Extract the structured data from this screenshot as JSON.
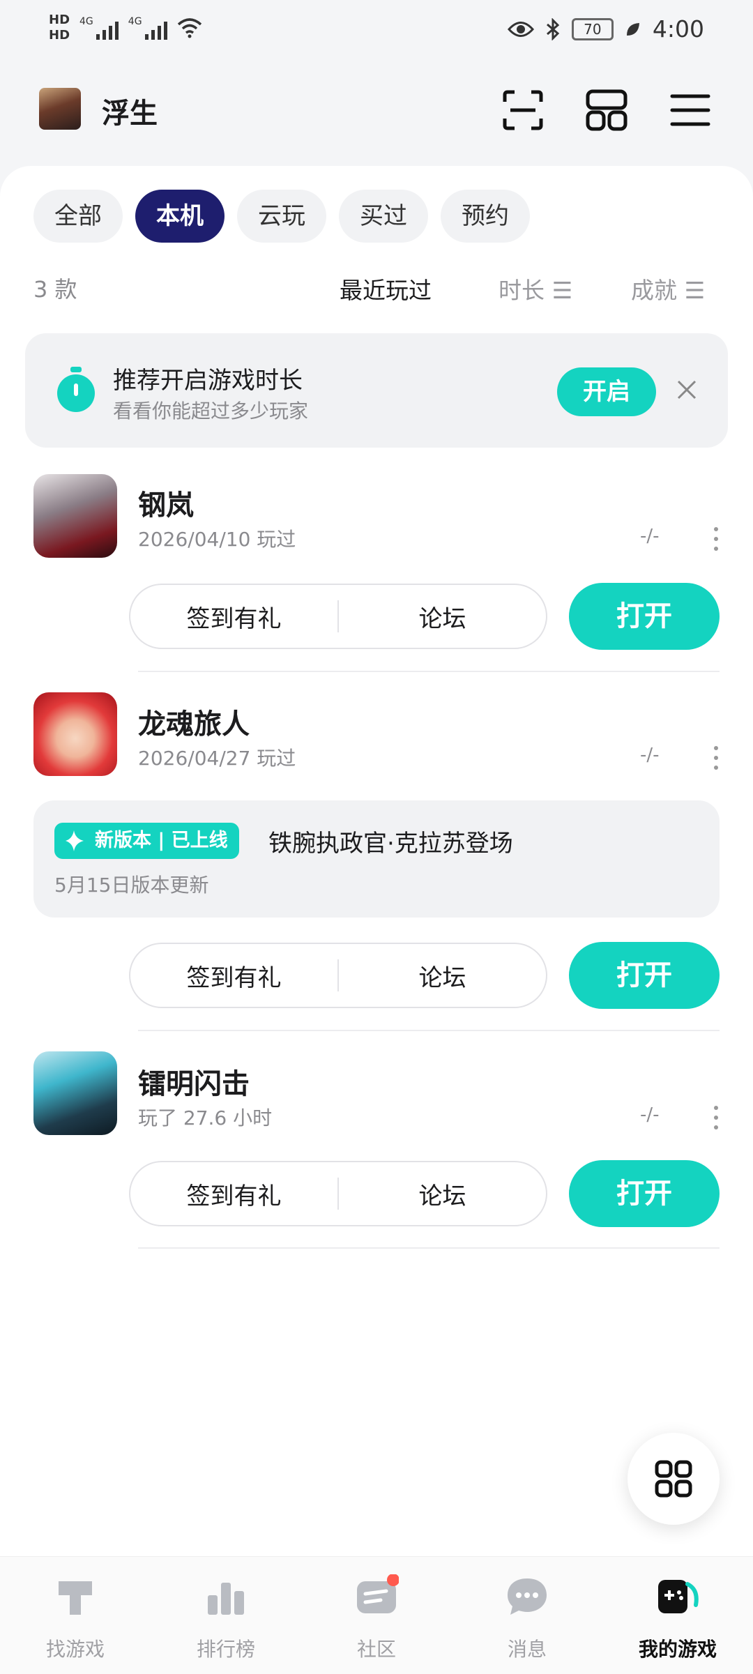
{
  "status_bar": {
    "hd1": "HD",
    "hd2": "HD",
    "net1": "4G",
    "net2": "4G",
    "battery": "70",
    "time": "4:00"
  },
  "header": {
    "username": "浮生"
  },
  "filter_tabs": [
    "全部",
    "本机",
    "云玩",
    "买过",
    "预约"
  ],
  "active_tab": "本机",
  "list_header": {
    "count": "3 款",
    "sort_recent": "最近玩过",
    "sort_duration": "时长 ☰",
    "sort_achievement": "成就 ☰"
  },
  "promo": {
    "title": "推荐开启游戏时长",
    "subtitle": "看看你能超过多少玩家",
    "button": "开启"
  },
  "games": [
    {
      "name": "钢岚",
      "meta": "2026/04/10 玩过",
      "stat": "-/-",
      "action_left": "签到有礼",
      "action_right": "论坛",
      "open": "打开"
    },
    {
      "name": "龙魂旅人",
      "meta": "2026/04/27 玩过",
      "stat": "-/-",
      "update_badge": "新版本 | 已上线",
      "update_title": "铁腕执政官·克拉苏登场",
      "update_sub": "5月15日版本更新",
      "action_left": "签到有礼",
      "action_right": "论坛",
      "open": "打开"
    },
    {
      "name": "镭明闪击",
      "meta": "玩了 27.6 小时",
      "stat": "-/-",
      "action_left": "签到有礼",
      "action_right": "论坛",
      "open": "打开"
    }
  ],
  "bottom_nav": [
    {
      "label": "找游戏",
      "icon": "find-games-icon"
    },
    {
      "label": "排行榜",
      "icon": "ranking-icon"
    },
    {
      "label": "社区",
      "icon": "community-icon"
    },
    {
      "label": "消息",
      "icon": "messages-icon"
    },
    {
      "label": "我的游戏",
      "icon": "my-games-icon"
    }
  ],
  "colors": {
    "accent": "#14d3c0",
    "active_tab": "#1e1e6e",
    "badge_dot": "#ff5a4e"
  }
}
